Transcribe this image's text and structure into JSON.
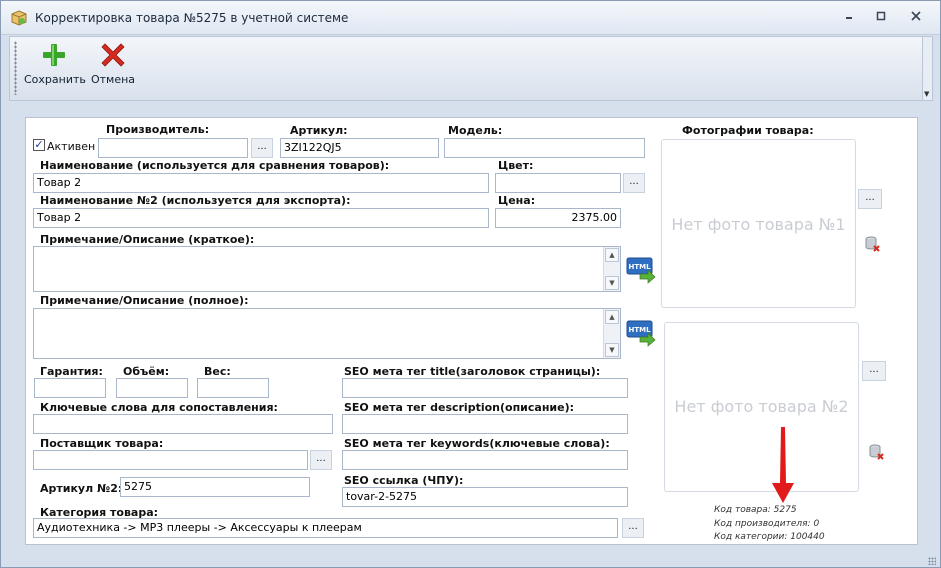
{
  "window": {
    "title": "Корректировка товара №5275 в учетной системе",
    "min_icon": "minimize-icon",
    "max_icon": "maximize-icon",
    "close_icon": "close-icon"
  },
  "toolbar": {
    "save_label": "Сохранить",
    "cancel_label": "Отмена",
    "save_icon": "green-plus-icon",
    "cancel_icon": "red-x-icon"
  },
  "form": {
    "active_label": "Активен",
    "active_checked": true,
    "manufacturer_label": "Производитель:",
    "manufacturer_value": "",
    "article_label": "Артикул:",
    "article_value": "3ZI122QJ5",
    "model_label": "Модель:",
    "model_value": "",
    "name_label": "Наименование (используется для сравнения товаров):",
    "name_value": "Товар 2",
    "color_label": "Цвет:",
    "color_value": "",
    "name2_label": "Наименование №2 (используется для экспорта):",
    "name2_value": "Товар 2",
    "price_label": "Цена:",
    "price_value": "2375.00",
    "short_desc_label": "Примечание/Описание (краткое):",
    "full_desc_label": "Примечание/Описание (полное):",
    "warranty_label": "Гарантия:",
    "volume_label": "Объём:",
    "weight_label": "Вес:",
    "keywords_label": "Ключевые слова для сопоставления:",
    "supplier_label": "Поставщик товара:",
    "article2_label": "Артикул №2:",
    "article2_value": "5275",
    "category_label": "Категория товара:",
    "category_value": "Аудиотехника -> MP3 плееры -> Аксессуары к плеерам",
    "seo_title_label": "SEO мета тег title(заголовок страницы):",
    "seo_desc_label": "SEO мета тег description(описание):",
    "seo_keywords_label": "SEO мета тег keywords(ключевые слова):",
    "seo_url_label": "SEO ссылка (ЧПУ):",
    "seo_url_value": "tovar-2-5275",
    "dots_label": "..."
  },
  "photos": {
    "heading": "Фотографии товара:",
    "photo1_text": "Нет фото товара №1",
    "photo2_text": "Нет фото товара №2",
    "delete_icon": "delete-photo-icon"
  },
  "info": {
    "product_code": "Код товара: 5275",
    "manufacturer_code": "Код производителя: 0",
    "category_code": "Код категории: 100440"
  },
  "colors": {
    "arrow": "#e11b1b",
    "plus": "#3aa52b",
    "cancel": "#d52a1e"
  }
}
